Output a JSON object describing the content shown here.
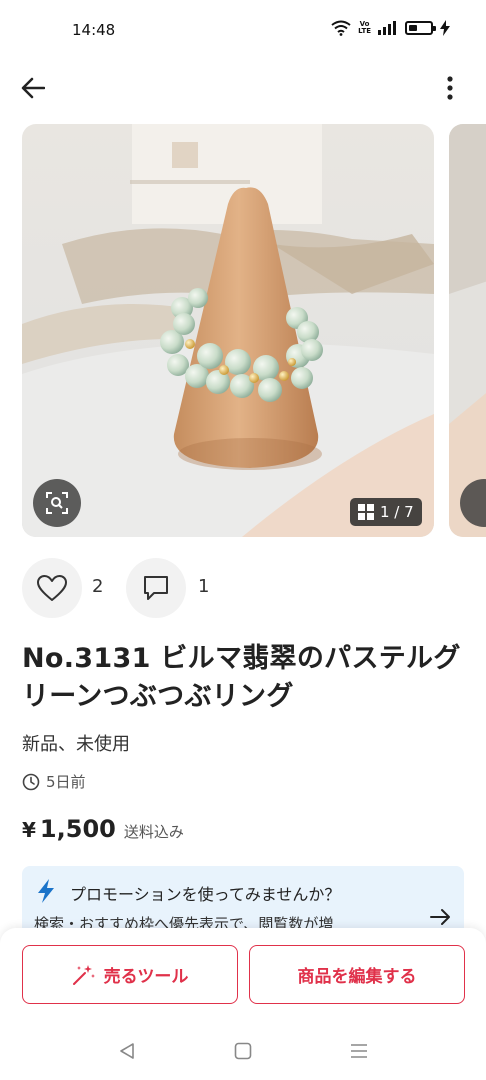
{
  "status_bar": {
    "time": "14:48",
    "icons": [
      "wifi-icon",
      "volte-icon",
      "signal-icon",
      "battery-icon",
      "charging-icon"
    ],
    "volte_top": "Vo",
    "volte_bottom": "LTE"
  },
  "nav": {
    "back_icon": "arrow-left-icon",
    "more_icon": "more-vertical-icon"
  },
  "gallery": {
    "counter": "1 / 7",
    "lens_icon": "image-search-icon",
    "grid_icon": "grid-icon"
  },
  "actions": {
    "like_icon": "heart-icon",
    "like_count": "2",
    "comment_icon": "comment-icon",
    "comment_count": "1"
  },
  "item": {
    "title": "No.3131 ビルマ翡翠のパステルグリーンつぶつぶリング",
    "condition": "新品、未使用",
    "posted": "5日前",
    "price_symbol": "¥",
    "price": "1,500",
    "shipping": "送料込み"
  },
  "promotion": {
    "title": "プロモーションを使ってみませんか？",
    "description": "検索・おすすめ枠へ優先表示で、閲覧数が増",
    "icon": "bolt-icon",
    "arrow_icon": "arrow-right-icon"
  },
  "buttons": {
    "sell_tools": "売るツール",
    "edit_item": "商品を編集する",
    "sell_tools_icon": "sparkle-wand-icon"
  },
  "colors": {
    "accent": "#e0314a",
    "promo_bg": "#e8f3fc",
    "bolt": "#1a73c9"
  }
}
